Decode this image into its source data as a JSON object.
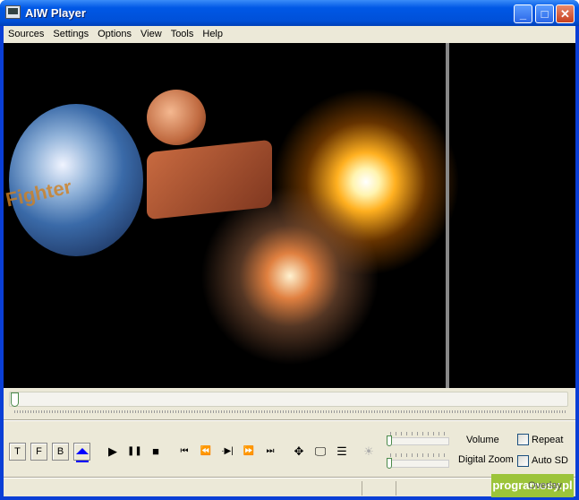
{
  "window": {
    "title": "AIW Player",
    "minimize": "_",
    "maximize": "□",
    "close": "✕"
  },
  "menu": [
    "Sources",
    "Settings",
    "Options",
    "View",
    "Tools",
    "Help"
  ],
  "video": {
    "overlay_text": "Fighter"
  },
  "seek": {
    "position_percent": 0
  },
  "buttons": {
    "t": "T",
    "f": "F",
    "b": "B"
  },
  "controls": {
    "play": "▶",
    "pause": "❚❚",
    "stop": "■",
    "prev": "⏮",
    "rewind": "⏪",
    "step": "·▶|",
    "forward": "⏩",
    "next": "⏭",
    "fullscreen": "✥",
    "display": "🖵",
    "list": "☰",
    "brightness": "☀"
  },
  "volume": {
    "label": "Volume",
    "level_percent": 0
  },
  "zoom": {
    "label": "Digital Zoom",
    "level_percent": 0
  },
  "checkboxes": {
    "repeat": {
      "label": "Repeat",
      "checked": false
    },
    "auto_sd": {
      "label": "Auto SD",
      "checked": false
    }
  },
  "status": {
    "overlay": "Overlay"
  },
  "watermark": "programosy.pl",
  "colors": {
    "titlebar": "#0058e6",
    "chrome": "#ece9d8",
    "eject": "#0000ff"
  }
}
